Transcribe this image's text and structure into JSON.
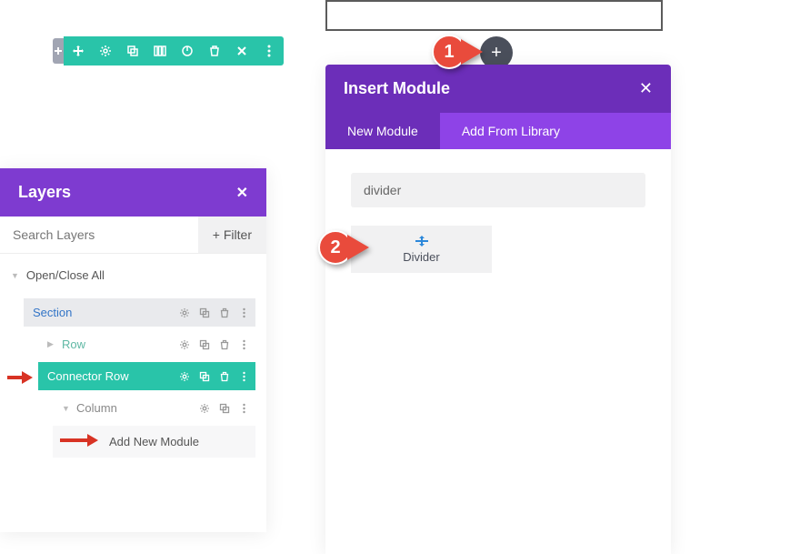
{
  "toolbar": {
    "icons": [
      "move",
      "settings",
      "duplicate",
      "columns",
      "save",
      "delete",
      "close",
      "more"
    ]
  },
  "preview": {
    "add": "+"
  },
  "callouts": {
    "one": "1",
    "two": "2"
  },
  "modal": {
    "title": "Insert Module",
    "tabs": {
      "new": "New Module",
      "library": "Add From Library"
    },
    "search_value": "divider",
    "result": {
      "label": "Divider"
    }
  },
  "layers": {
    "title": "Layers",
    "search_placeholder": "Search Layers",
    "filter": "Filter",
    "toggle": "Open/Close All",
    "items": {
      "section": "Section",
      "row": "Row",
      "connector": "Connector Row",
      "column": "Column",
      "addnew": "Add New Module"
    }
  }
}
